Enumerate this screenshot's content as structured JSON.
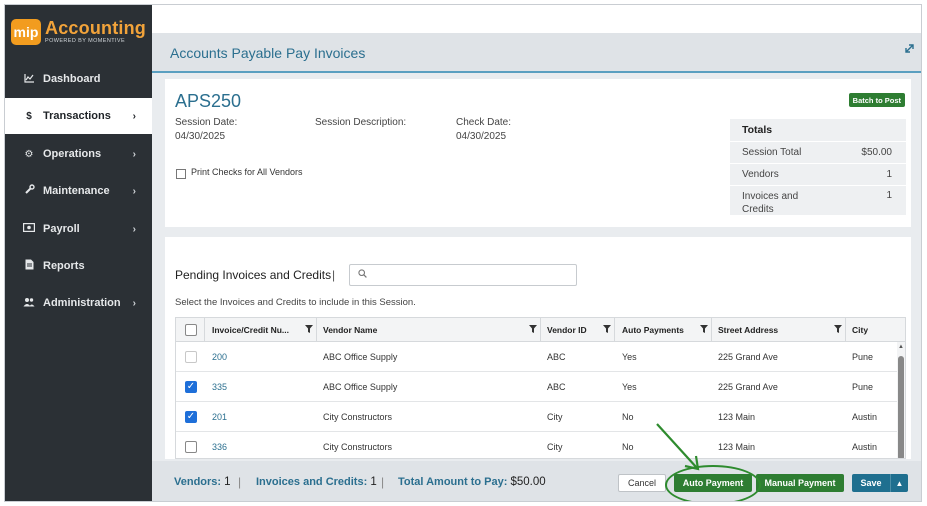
{
  "brand": {
    "logo_mark": "mip",
    "name": "Accounting",
    "tagline": "POWERED BY MOMENTIVE"
  },
  "sidebar": {
    "items": [
      {
        "label": "Dashboard",
        "icon": "chart-line-icon",
        "chevron": false,
        "active": false
      },
      {
        "label": "Transactions",
        "icon": "dollar-icon",
        "chevron": true,
        "active": true
      },
      {
        "label": "Operations",
        "icon": "gears-icon",
        "chevron": true,
        "active": false
      },
      {
        "label": "Maintenance",
        "icon": "wrench-icon",
        "chevron": true,
        "active": false
      },
      {
        "label": "Payroll",
        "icon": "money-icon",
        "chevron": true,
        "active": false
      },
      {
        "label": "Reports",
        "icon": "report-icon",
        "chevron": false,
        "active": false
      },
      {
        "label": "Administration",
        "icon": "users-icon",
        "chevron": true,
        "active": false
      }
    ]
  },
  "header": {
    "title": "Accounts Payable Pay Invoices"
  },
  "session": {
    "id": "APS250",
    "date_label": "Session Date:",
    "date_value": "04/30/2025",
    "desc_label": "Session Description:",
    "check_label": "Check Date:",
    "check_value": "04/30/2025",
    "print_checks_label": "Print Checks for All Vendors",
    "batch_button": "Batch to Post"
  },
  "totals": {
    "heading": "Totals",
    "rows": [
      {
        "label": "Session Total",
        "value": "$50.00"
      },
      {
        "label": "Vendors",
        "value": "1"
      },
      {
        "label": "Invoices and Credits",
        "value": "1"
      }
    ]
  },
  "pending": {
    "title": "Pending Invoices and Credits",
    "separator": "|",
    "search_placeholder": "",
    "subtitle": "Select the Invoices and Credits to include in this Session.",
    "columns": [
      "Invoice/Credit Nu...",
      "Vendor Name",
      "Vendor ID",
      "Auto Payments",
      "Street Address",
      "City"
    ],
    "rows": [
      {
        "checked": false,
        "disabled": true,
        "invoice": "200",
        "vendor": "ABC Office Supply",
        "vendor_id": "ABC",
        "auto": "Yes",
        "address": "225 Grand Ave",
        "city": "Pune"
      },
      {
        "checked": true,
        "disabled": false,
        "invoice": "335",
        "vendor": "ABC Office Supply",
        "vendor_id": "ABC",
        "auto": "Yes",
        "address": "225 Grand Ave",
        "city": "Pune"
      },
      {
        "checked": true,
        "disabled": false,
        "invoice": "201",
        "vendor": "City Constructors",
        "vendor_id": "City",
        "auto": "No",
        "address": "123 Main",
        "city": "Austin"
      },
      {
        "checked": false,
        "disabled": false,
        "invoice": "336",
        "vendor": "City Constructors",
        "vendor_id": "City",
        "auto": "No",
        "address": "123 Main",
        "city": "Austin"
      }
    ]
  },
  "footer": {
    "vendors_label": "Vendors:",
    "vendors_value": "1",
    "invoices_label": "Invoices and Credits:",
    "invoices_value": "1",
    "total_label": "Total Amount to Pay:",
    "total_value": "$50.00",
    "bar": "|",
    "cancel": "Cancel",
    "auto_payment": "Auto Payment",
    "manual_payment": "Manual Payment",
    "save": "Save"
  },
  "colors": {
    "accent": "#2b6f8f",
    "sidebar": "#2b3035",
    "primary_green": "#2e7d32",
    "annotation": "#2e8b2e",
    "logo": "#f29c1f"
  }
}
